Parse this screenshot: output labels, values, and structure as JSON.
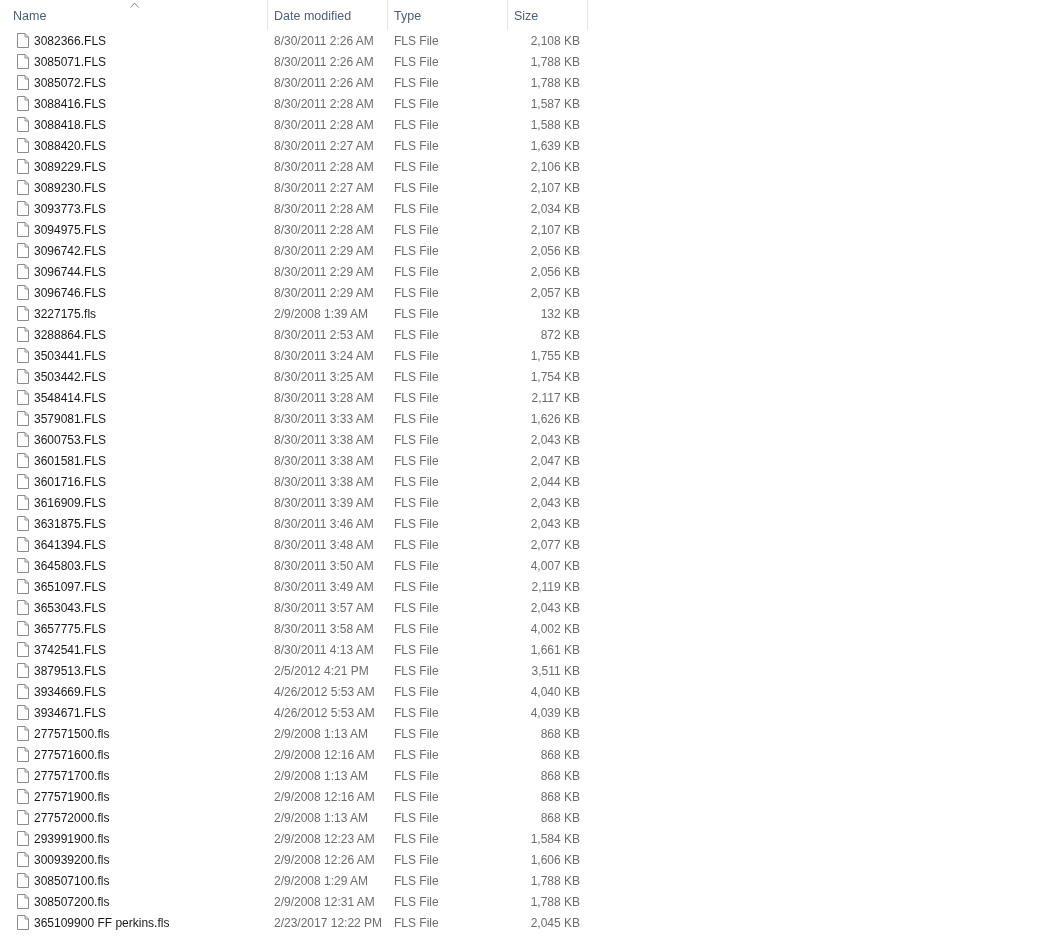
{
  "columns": [
    {
      "label": "Name",
      "sorted": true
    },
    {
      "label": "Date modified",
      "sorted": false
    },
    {
      "label": "Type",
      "sorted": false
    },
    {
      "label": "Size",
      "sorted": false
    }
  ],
  "files": [
    {
      "name": "3082366.FLS",
      "date": "8/30/2011 2:26 AM",
      "type": "FLS File",
      "size": "2,108 KB"
    },
    {
      "name": "3085071.FLS",
      "date": "8/30/2011 2:26 AM",
      "type": "FLS File",
      "size": "1,788 KB"
    },
    {
      "name": "3085072.FLS",
      "date": "8/30/2011 2:26 AM",
      "type": "FLS File",
      "size": "1,788 KB"
    },
    {
      "name": "3088416.FLS",
      "date": "8/30/2011 2:28 AM",
      "type": "FLS File",
      "size": "1,587 KB"
    },
    {
      "name": "3088418.FLS",
      "date": "8/30/2011 2:28 AM",
      "type": "FLS File",
      "size": "1,588 KB"
    },
    {
      "name": "3088420.FLS",
      "date": "8/30/2011 2:27 AM",
      "type": "FLS File",
      "size": "1,639 KB"
    },
    {
      "name": "3089229.FLS",
      "date": "8/30/2011 2:28 AM",
      "type": "FLS File",
      "size": "2,106 KB"
    },
    {
      "name": "3089230.FLS",
      "date": "8/30/2011 2:27 AM",
      "type": "FLS File",
      "size": "2,107 KB"
    },
    {
      "name": "3093773.FLS",
      "date": "8/30/2011 2:28 AM",
      "type": "FLS File",
      "size": "2,034 KB"
    },
    {
      "name": "3094975.FLS",
      "date": "8/30/2011 2:28 AM",
      "type": "FLS File",
      "size": "2,107 KB"
    },
    {
      "name": "3096742.FLS",
      "date": "8/30/2011 2:29 AM",
      "type": "FLS File",
      "size": "2,056 KB"
    },
    {
      "name": "3096744.FLS",
      "date": "8/30/2011 2:29 AM",
      "type": "FLS File",
      "size": "2,056 KB"
    },
    {
      "name": "3096746.FLS",
      "date": "8/30/2011 2:29 AM",
      "type": "FLS File",
      "size": "2,057 KB"
    },
    {
      "name": "3227175.fls",
      "date": "2/9/2008 1:39 AM",
      "type": "FLS File",
      "size": "132 KB"
    },
    {
      "name": "3288864.FLS",
      "date": "8/30/2011 2:53 AM",
      "type": "FLS File",
      "size": "872 KB"
    },
    {
      "name": "3503441.FLS",
      "date": "8/30/2011 3:24 AM",
      "type": "FLS File",
      "size": "1,755 KB"
    },
    {
      "name": "3503442.FLS",
      "date": "8/30/2011 3:25 AM",
      "type": "FLS File",
      "size": "1,754 KB"
    },
    {
      "name": "3548414.FLS",
      "date": "8/30/2011 3:28 AM",
      "type": "FLS File",
      "size": "2,117 KB"
    },
    {
      "name": "3579081.FLS",
      "date": "8/30/2011 3:33 AM",
      "type": "FLS File",
      "size": "1,626 KB"
    },
    {
      "name": "3600753.FLS",
      "date": "8/30/2011 3:38 AM",
      "type": "FLS File",
      "size": "2,043 KB"
    },
    {
      "name": "3601581.FLS",
      "date": "8/30/2011 3:38 AM",
      "type": "FLS File",
      "size": "2,047 KB"
    },
    {
      "name": "3601716.FLS",
      "date": "8/30/2011 3:38 AM",
      "type": "FLS File",
      "size": "2,044 KB"
    },
    {
      "name": "3616909.FLS",
      "date": "8/30/2011 3:39 AM",
      "type": "FLS File",
      "size": "2,043 KB"
    },
    {
      "name": "3631875.FLS",
      "date": "8/30/2011 3:46 AM",
      "type": "FLS File",
      "size": "2,043 KB"
    },
    {
      "name": "3641394.FLS",
      "date": "8/30/2011 3:48 AM",
      "type": "FLS File",
      "size": "2,077 KB"
    },
    {
      "name": "3645803.FLS",
      "date": "8/30/2011 3:50 AM",
      "type": "FLS File",
      "size": "4,007 KB"
    },
    {
      "name": "3651097.FLS",
      "date": "8/30/2011 3:49 AM",
      "type": "FLS File",
      "size": "2,119 KB"
    },
    {
      "name": "3653043.FLS",
      "date": "8/30/2011 3:57 AM",
      "type": "FLS File",
      "size": "2,043 KB"
    },
    {
      "name": "3657775.FLS",
      "date": "8/30/2011 3:58 AM",
      "type": "FLS File",
      "size": "4,002 KB"
    },
    {
      "name": "3742541.FLS",
      "date": "8/30/2011 4:13 AM",
      "type": "FLS File",
      "size": "1,661 KB"
    },
    {
      "name": "3879513.FLS",
      "date": "2/5/2012 4:21 PM",
      "type": "FLS File",
      "size": "3,511 KB"
    },
    {
      "name": "3934669.FLS",
      "date": "4/26/2012 5:53 AM",
      "type": "FLS File",
      "size": "4,040 KB"
    },
    {
      "name": "3934671.FLS",
      "date": "4/26/2012 5:53 AM",
      "type": "FLS File",
      "size": "4,039 KB"
    },
    {
      "name": "277571500.fls",
      "date": "2/9/2008 1:13 AM",
      "type": "FLS File",
      "size": "868 KB"
    },
    {
      "name": "277571600.fls",
      "date": "2/9/2008 12:16 AM",
      "type": "FLS File",
      "size": "868 KB"
    },
    {
      "name": "277571700.fls",
      "date": "2/9/2008 1:13 AM",
      "type": "FLS File",
      "size": "868 KB"
    },
    {
      "name": "277571900.fls",
      "date": "2/9/2008 12:16 AM",
      "type": "FLS File",
      "size": "868 KB"
    },
    {
      "name": "277572000.fls",
      "date": "2/9/2008 1:13 AM",
      "type": "FLS File",
      "size": "868 KB"
    },
    {
      "name": "293991900.fls",
      "date": "2/9/2008 12:23 AM",
      "type": "FLS File",
      "size": "1,584 KB"
    },
    {
      "name": "300939200.fls",
      "date": "2/9/2008 12:26 AM",
      "type": "FLS File",
      "size": "1,606 KB"
    },
    {
      "name": "308507100.fls",
      "date": "2/9/2008 1:29 AM",
      "type": "FLS File",
      "size": "1,788 KB"
    },
    {
      "name": "308507200.fls",
      "date": "2/9/2008 12:31 AM",
      "type": "FLS File",
      "size": "1,788 KB"
    },
    {
      "name": "365109900 FF perkins.fls",
      "date": "2/23/2017 12:22 PM",
      "type": "FLS File",
      "size": "2,045 KB"
    }
  ]
}
